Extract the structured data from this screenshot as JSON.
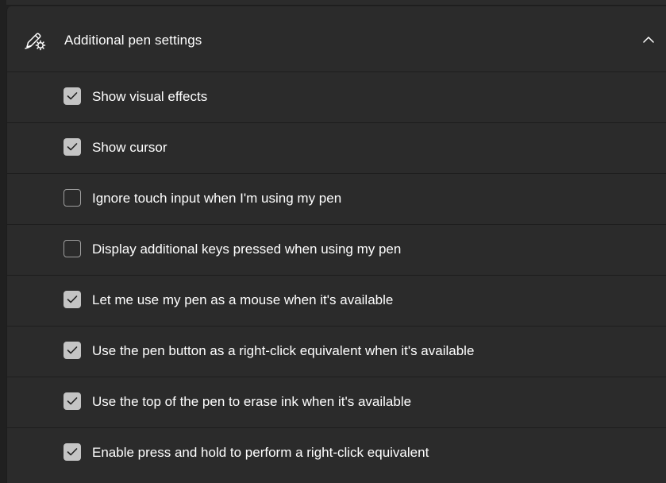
{
  "section": {
    "title": "Additional pen settings",
    "icon": "pen-settings-icon",
    "expanded": true,
    "collapse_icon": "chevron-up-icon"
  },
  "options": [
    {
      "label": "Show visual effects",
      "checked": true
    },
    {
      "label": "Show cursor",
      "checked": true
    },
    {
      "label": "Ignore touch input when I'm using my pen",
      "checked": false
    },
    {
      "label": "Display additional keys pressed when using my pen",
      "checked": false
    },
    {
      "label": "Let me use my pen as a mouse when it's available",
      "checked": true
    },
    {
      "label": "Use the pen button as a right-click equivalent when it's available",
      "checked": true
    },
    {
      "label": "Use the top of the pen to erase ink when it's available",
      "checked": true
    },
    {
      "label": "Enable press and hold to perform a right-click equivalent",
      "checked": true
    }
  ],
  "colors": {
    "background": "#202020",
    "card": "#2b2b2b",
    "checkbox_checked": "#c4c4c4",
    "checkmark": "#1f1f1f"
  }
}
